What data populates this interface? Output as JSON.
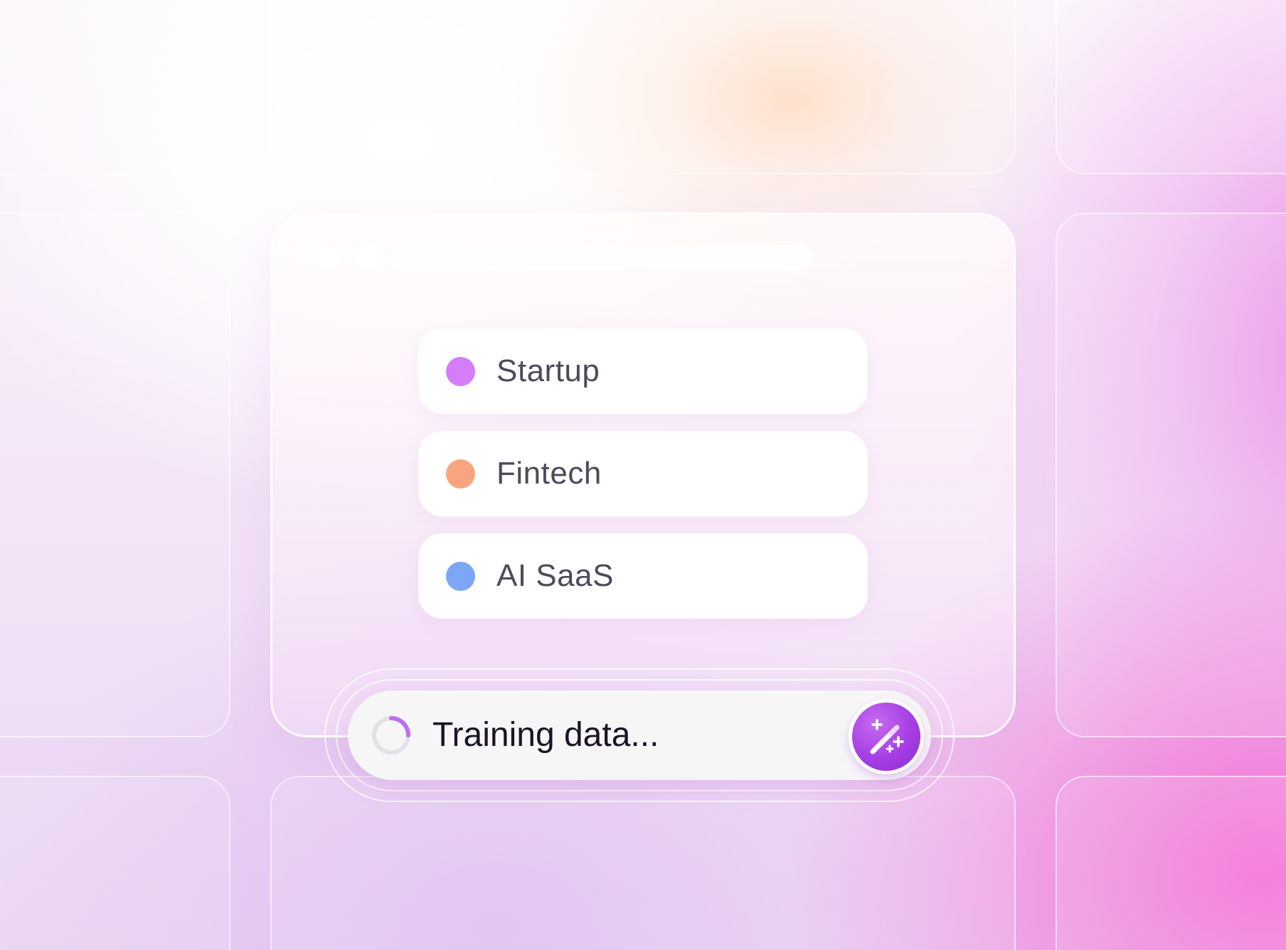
{
  "options": [
    {
      "label": "Startup",
      "color": "#d57df7"
    },
    {
      "label": "Fintech",
      "color": "#f8a57f"
    },
    {
      "label": "AI SaaS",
      "color": "#7ba7f6"
    }
  ],
  "status": {
    "text": "Training data...",
    "spinner_color": "#c26df0",
    "button_icon": "magic-wand-icon",
    "button_color": "#a53ee3"
  }
}
